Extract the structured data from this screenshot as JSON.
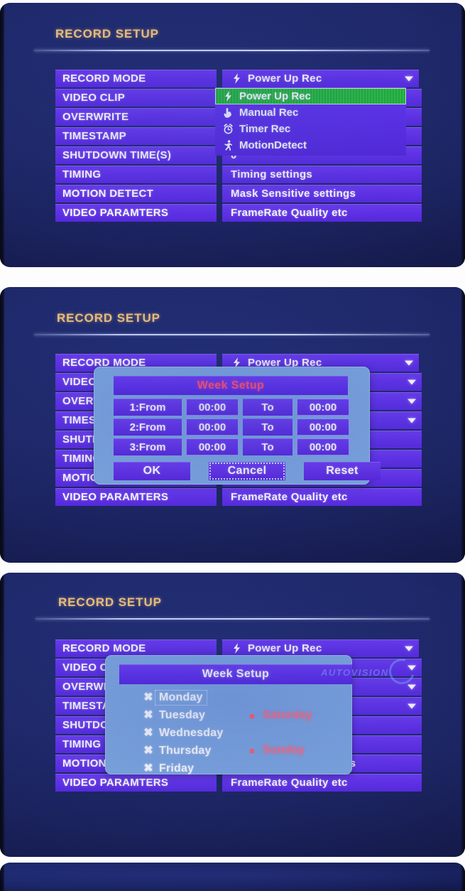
{
  "screen": {
    "title": "RECORD SETUP"
  },
  "menu": {
    "rows": [
      {
        "label": "RECORD MODE",
        "value": "Power Up Rec",
        "caret": true,
        "icon": "bolt-icon"
      },
      {
        "label": "VIDEO CLIP",
        "value": "",
        "caret": true,
        "icon": ""
      },
      {
        "label": "OVERWRITE",
        "value": "",
        "caret": true,
        "icon": ""
      },
      {
        "label": "TIMESTAMP",
        "value": "",
        "caret": true,
        "icon": ""
      },
      {
        "label": "SHUTDOWN TIME(S)",
        "value": "0",
        "caret": false,
        "icon": ""
      },
      {
        "label": "TIMING",
        "value": "Timing settings",
        "caret": false,
        "icon": ""
      },
      {
        "label": "MOTION DETECT",
        "value": "Mask Sensitive settings",
        "caret": false,
        "icon": ""
      },
      {
        "label": "VIDEO PARAMTERS",
        "value": "FrameRate Quality etc",
        "caret": false,
        "icon": ""
      }
    ]
  },
  "dropdown": {
    "options": [
      {
        "label": "Power Up Rec",
        "icon": "bolt-icon",
        "selected": true
      },
      {
        "label": "Manual Rec",
        "icon": "hand-pointer-icon",
        "selected": false
      },
      {
        "label": "Timer Rec",
        "icon": "alarm-clock-icon",
        "selected": false
      },
      {
        "label": "MotionDetect",
        "icon": "running-person-icon",
        "selected": false
      }
    ]
  },
  "week_time_dialog": {
    "title": "Week Setup",
    "rows": [
      {
        "from_label": "1:From",
        "from_value": "00:00",
        "to_label": "To",
        "to_value": "00:00"
      },
      {
        "from_label": "2:From",
        "from_value": "00:00",
        "to_label": "To",
        "to_value": "00:00"
      },
      {
        "from_label": "3:From",
        "from_value": "00:00",
        "to_label": "To",
        "to_value": "00:00"
      }
    ],
    "buttons": [
      {
        "label": "OK",
        "focused": false
      },
      {
        "label": "Cancel",
        "focused": true
      },
      {
        "label": "Reset",
        "focused": false
      }
    ]
  },
  "week_days_dialog": {
    "title": "Week Setup",
    "weekdays": [
      {
        "label": "Monday",
        "mark": "x",
        "focused": true
      },
      {
        "label": "Tuesday",
        "mark": "x",
        "focused": false
      },
      {
        "label": "Wednesday",
        "mark": "x",
        "focused": false
      },
      {
        "label": "Thursday",
        "mark": "x",
        "focused": false
      },
      {
        "label": "Friday",
        "mark": "x",
        "focused": false
      }
    ],
    "weekend": [
      {
        "label": "Saturday",
        "mark": "square"
      },
      {
        "label": "Sunday",
        "mark": "square"
      }
    ],
    "watermark": "AUTOVISION"
  },
  "colors": {
    "screen_bg": "#1b2566",
    "row_purple": "#5f2ee8",
    "title_gold": "#f0c277",
    "highlight_green": "#25c43a",
    "dialog_blue": "#7ba6dd",
    "pink": "#ff4d6e",
    "weekend_pink": "#ff6b7d"
  },
  "marks": {
    "x": "✖",
    "square": "■"
  }
}
